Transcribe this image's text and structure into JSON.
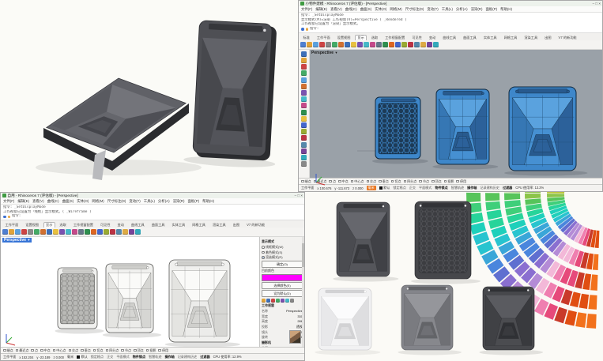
{
  "tr_window": {
    "title": "小物件建模 - Rhinoceros 7 (评估版) - [Perspective]",
    "window_buttons": "– □ ×",
    "menus": [
      "文件(F)",
      "编辑(E)",
      "查看(V)",
      "曲线(C)",
      "曲面(S)",
      "实体(O)",
      "网格(M)",
      "尺寸标注(D)",
      "变动(T)",
      "工具(L)",
      "分析(A)",
      "渲染(R)",
      "面板(P)",
      "帮助(H)"
    ],
    "command_lines": [
      "指令: _SetDisplayMode",
      "显示模式(M)=渲染  工作视窗(V)=Perspective ( _Rendered )",
      "工作视窗已设置为「渲染」显示模式。"
    ],
    "prompt": "指令:",
    "tabs": [
      "标准",
      "工作平面",
      "设置视图",
      "显示",
      "选取",
      "工作视窗配置",
      "可见性",
      "变动",
      "曲线工具",
      "曲面工具",
      "实体工具",
      "网格工具",
      "渲染工具",
      "出图",
      "V7 的新功能"
    ],
    "active_tab": "显示",
    "viewport_label": "Perspective",
    "osnap_items": [
      "端点",
      "最近点",
      "点",
      "中点",
      "中心点",
      "交点",
      "垂点",
      "切点",
      "四分点",
      "节点",
      "顶点",
      "投影",
      "停用"
    ],
    "status": {
      "cplane": "工作平面",
      "x": "x 100.676",
      "y": "y -111.673",
      "z": "z 0.000",
      "units": "毫米",
      "layer": "默认",
      "toggles": [
        {
          "label": "锁定格点",
          "active": false
        },
        {
          "label": "正交",
          "active": false
        },
        {
          "label": "平面模式",
          "active": false
        },
        {
          "label": "物件锁点",
          "active": true
        },
        {
          "label": "智慧轨迹",
          "active": false
        },
        {
          "label": "操作轴",
          "active": true
        },
        {
          "label": "记录建构历史",
          "active": false
        },
        {
          "label": "过滤器",
          "active": true
        }
      ],
      "cpu": "CPU 使用率: 13.2%"
    }
  },
  "bl_window": {
    "title": "自用 - Rhinoceros 7 (评估版) - [Perspective]",
    "window_buttons": "– □ ×",
    "menus": [
      "文件(F)",
      "编辑(E)",
      "查看(V)",
      "曲线(C)",
      "曲面(S)",
      "实体(O)",
      "网格(M)",
      "尺寸标注(D)",
      "变动(T)",
      "工具(L)",
      "分析(A)",
      "渲染(R)",
      "面板(P)",
      "帮助(H)"
    ],
    "command_lines": [
      "指令: _SetDisplayMode",
      "工作视窗已设置为「线框」显示模式。( _Wireframe )"
    ],
    "prompt": "指令:",
    "tabs": [
      "工作平面",
      "设置视图",
      "显示",
      "选取",
      "工作视窗配置",
      "可见性",
      "变动",
      "曲线工具",
      "曲面工具",
      "实体工具",
      "网格工具",
      "渲染工具",
      "出图",
      "V7 的新功能"
    ],
    "active_tab": "显示",
    "viewport_label": "Perspective",
    "osnap_items": [
      "端点",
      "最近点",
      "点",
      "中点",
      "中心点",
      "交点",
      "垂点",
      "切点",
      "四分点",
      "节点",
      "顶点",
      "投影",
      "停用"
    ],
    "status": {
      "cplane": "工作平面",
      "x": "x 152.204",
      "y": "y -23.189",
      "z": "z 0.000",
      "units": "毫米",
      "layer": "默认",
      "toggles": [
        {
          "label": "锁定格点",
          "active": false
        },
        {
          "label": "正交",
          "active": false
        },
        {
          "label": "平面模式",
          "active": false
        },
        {
          "label": "物件锁点",
          "active": true
        },
        {
          "label": "智慧轨迹",
          "active": false
        },
        {
          "label": "操作轴",
          "active": true
        },
        {
          "label": "记录建构历史",
          "active": false
        },
        {
          "label": "过滤器",
          "active": true
        }
      ],
      "cpu": "CPU 使用率: 12.9%"
    },
    "panel": {
      "display_title": "显示模式",
      "radios": [
        {
          "label": "线框模式(W)",
          "checked": false
        },
        {
          "label": "着色模式(S)",
          "checked": false
        },
        {
          "label": "渲染模式(R)",
          "checked": true
        }
      ],
      "ok_button": "确定(O)",
      "color_label": "目前颜色",
      "swatch_color": "#ff00ff",
      "color_buttons": [
        "选择颜色(E)",
        "设为默认(D)"
      ],
      "viewport_section": "工作视窗",
      "viewport_rows": [
        {
          "k": "名称",
          "v": "Perspective"
        },
        {
          "k": "宽度",
          "v": "331"
        },
        {
          "k": "高度",
          "v": "286"
        },
        {
          "k": "投影",
          "v": "透视"
        },
        {
          "k": "镜头",
          "v": "50.0"
        },
        {
          "k": "旋转",
          "v": "0.0"
        }
      ],
      "camera_section": "摄影机",
      "camera_rows": [
        {
          "k": "焦距",
          "v": "50.0"
        },
        {
          "k": "x 轴",
          "v": "0.000"
        }
      ]
    }
  },
  "materials": {
    "viewport_bg_gray": "#9aa1a8",
    "cad_blue": {
      "base": "#3e87ca",
      "light": "#5aa2de",
      "mid": "#3677b4",
      "dark": "#2c619a",
      "band": "#4690d2",
      "pocket": "#285a8e",
      "edge": "#10293f",
      "iso": "#1f4a72",
      "hexfill": "#1d3b57"
    },
    "wire": {
      "base": "#f0f0ee",
      "light": "#fafaf8",
      "mid": "#e4e4e1",
      "dark": "#d6d6d3",
      "band": "#ececea",
      "pocket": "#cfcfcc",
      "edge": "#5a5a58",
      "iso": "#9a9a98",
      "hexfill": "#b9b9b6"
    },
    "render_dark": {
      "base": "#515257",
      "light": "#66676d",
      "mid": "#4a4b50",
      "dark": "#404146",
      "band": "#55565b",
      "pocket": "#37383c",
      "edge": "#2c2d31",
      "hexfill": "#3a3b3f"
    },
    "render_back": {
      "base": "#46474b",
      "light": "#56575c",
      "mid": "#3f4044",
      "dark": "#37383c",
      "band": "#46474b",
      "pocket": "#323337",
      "edge": "#26272b",
      "hexfill": "#3c3d41"
    },
    "render_white": {
      "base": "#f1f1f2",
      "light": "#fbfbfc",
      "mid": "#e8e8ea",
      "dark": "#dedee0",
      "band": "#f4f4f5",
      "pocket": "#d2d2d4",
      "edge": "#c6c6c8",
      "hexfill": "#e0e0e2"
    },
    "render_gray": {
      "base": "#83848a",
      "light": "#95969b",
      "mid": "#7a7b80",
      "dark": "#6f7075",
      "band": "#87888d",
      "pocket": "#636468",
      "edge": "#595a5e",
      "hexfill": "#74757a"
    },
    "render_dark2": {
      "base": "#47484c",
      "light": "#5a5b60",
      "mid": "#404145",
      "dark": "#393a3e",
      "band": "#4b4c50",
      "pocket": "#303135",
      "edge": "#232428",
      "hexfill": "#3a3b3f"
    },
    "persp_top": {
      "base": "#606167",
      "light": "#73747a",
      "mid": "#595a60",
      "dark": "#4e4f55",
      "band": "#65666c",
      "pocket": "#44454b",
      "edge": "#323338",
      "hexfill": "#4a4b50"
    },
    "persp_front": {
      "base": "#4e4f54",
      "light": "#616268",
      "mid": "#47484d",
      "dark": "#3e3f44",
      "band": "#53545a",
      "pocket": "#35363a",
      "edge": "#28292d",
      "hexfill": "#3a3b3f"
    },
    "thickness": "#2b2c2f",
    "kickstand": "#b9babd",
    "axis_x": "#cc3333",
    "axis_y": "#33aa33",
    "axis_z": "#3355cc"
  },
  "fan_palette": [
    "#f2711c",
    "#e04e12",
    "#c93a2a",
    "#e64a7b",
    "#ef7fb0",
    "#f3b8d8",
    "#b48bd6",
    "#8a6fd0",
    "#5f6fd0",
    "#4a86dd",
    "#3aa6d8",
    "#28c4cf",
    "#1ed0bb",
    "#27d49a",
    "#3fcf7a",
    "#57c45a",
    "#8cc44a",
    "#bcc53a"
  ],
  "icons": {
    "toolbar": [
      "#4f7fd0",
      "#e0a33a",
      "#5aa0dd",
      "#cc4444",
      "#8a8a8a",
      "#44aa66",
      "#d07030",
      "#3d6fb8",
      "#e8c040",
      "#7a52b0",
      "#45b8c8",
      "#c44a8a",
      "#667788",
      "#2f8f4f",
      "#dd6622",
      "#4466cc",
      "#99aa33",
      "#bb3344",
      "#5588aa",
      "#ddaa44",
      "#774499",
      "#33aabb"
    ],
    "sidebar": [
      "#3d6fb8",
      "#e0a33a",
      "#cc4444",
      "#44aa66",
      "#5aa0dd",
      "#d07030",
      "#7a52b0",
      "#45b8c8",
      "#c44a8a",
      "#2f8f4f",
      "#e8c040",
      "#4466cc",
      "#99aa33",
      "#bb3344",
      "#5588aa",
      "#774499",
      "#33aabb",
      "#888888"
    ],
    "panel_row": [
      "#e0a33a",
      "#3d6fb8",
      "#cc4444",
      "#44aa66",
      "#7a52b0",
      "#45b8c8",
      "#888888"
    ],
    "panel_row2": [
      "#dd3322",
      "#3d6fb8",
      "#e8c040",
      "#44aa66",
      "#c44a8a",
      "#5aa0dd",
      "#d07030"
    ]
  }
}
